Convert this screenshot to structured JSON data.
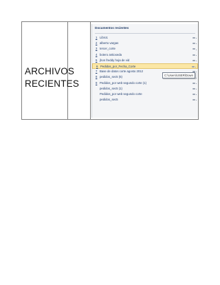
{
  "table": {
    "label_line1": "ARCHIVOS",
    "label_line2": "RECIENTES"
  },
  "recent_panel": {
    "title": "Documentos recientes",
    "items": [
      {
        "num": "1",
        "name": "Libro1"
      },
      {
        "num": "2",
        "name": "alberto vargas"
      },
      {
        "num": "3",
        "name": "tercer_corte"
      },
      {
        "num": "4",
        "name": "botero antioxeda"
      },
      {
        "num": "5",
        "name": "jhon freddy hoja de vid"
      },
      {
        "num": "6",
        "name": "Pedidos_por_Fecha_Corte",
        "selected": true
      },
      {
        "num": "7",
        "name": "Base de datos corte agosto 2012"
      },
      {
        "num": "8",
        "name": "pedidos_sec5 (5)"
      },
      {
        "num": "9",
        "name": "Pedidos_por web segundo corte (1)"
      },
      {
        "num": "",
        "name": "pedidos_sec5 (1)"
      },
      {
        "num": "",
        "name": "Pedidos_por web segundo corte"
      },
      {
        "num": "",
        "name": "pedidos_sec5"
      }
    ],
    "tooltip": "C:\\Users\\USER\\Down"
  }
}
